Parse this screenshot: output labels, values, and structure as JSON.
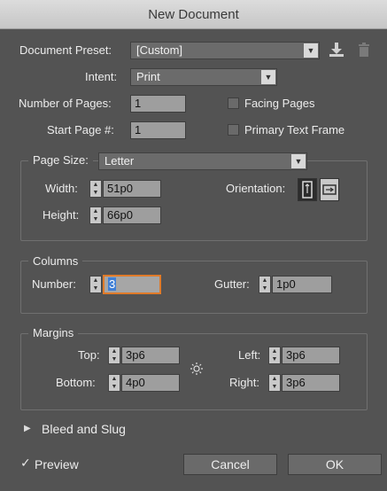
{
  "window": {
    "title": "New Document"
  },
  "preset": {
    "label": "Document Preset:",
    "value": "[Custom]"
  },
  "intent": {
    "label": "Intent:",
    "value": "Print"
  },
  "pages": {
    "label": "Number of Pages:",
    "value": "1"
  },
  "start_page": {
    "label": "Start Page #:",
    "value": "1"
  },
  "facing_pages": {
    "label": "Facing Pages",
    "checked": false
  },
  "primary_text_frame": {
    "label": "Primary Text Frame",
    "checked": false
  },
  "page_size": {
    "label": "Page Size:",
    "value": "Letter",
    "width_label": "Width:",
    "width": "51p0",
    "height_label": "Height:",
    "height": "66p0",
    "orientation_label": "Orientation:"
  },
  "columns": {
    "title": "Columns",
    "number_label": "Number:",
    "number": "3",
    "gutter_label": "Gutter:",
    "gutter": "1p0"
  },
  "margins": {
    "title": "Margins",
    "top_label": "Top:",
    "top": "3p6",
    "bottom_label": "Bottom:",
    "bottom": "4p0",
    "left_label": "Left:",
    "left": "3p6",
    "right_label": "Right:",
    "right": "3p6"
  },
  "bleed": {
    "label": "Bleed and Slug"
  },
  "preview": {
    "label": "Preview",
    "checked": true
  },
  "buttons": {
    "cancel": "Cancel",
    "ok": "OK"
  },
  "colors": {
    "panel": "#535353",
    "focus": "#e07b2a",
    "selection": "#3f7fd6"
  }
}
